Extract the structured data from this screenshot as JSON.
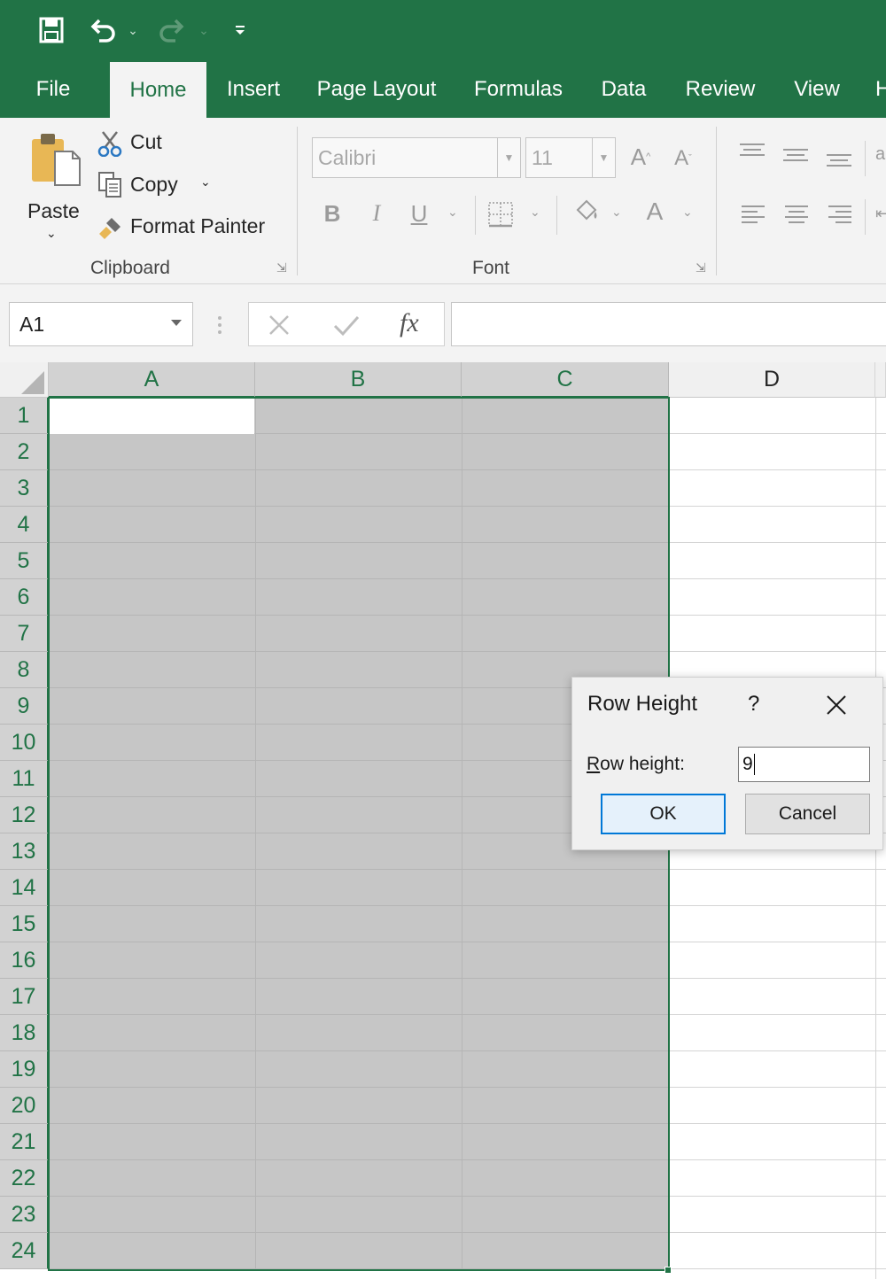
{
  "qat": {
    "save_icon": "save-icon",
    "undo_icon": "undo-icon",
    "redo_icon": "redo-icon",
    "customize_icon": "customize-qat-icon"
  },
  "tabs": [
    {
      "label": "File"
    },
    {
      "label": "Home"
    },
    {
      "label": "Insert"
    },
    {
      "label": "Page Layout"
    },
    {
      "label": "Formulas"
    },
    {
      "label": "Data"
    },
    {
      "label": "Review"
    },
    {
      "label": "View"
    },
    {
      "label": "H"
    }
  ],
  "ribbon": {
    "clipboard": {
      "paste": "Paste",
      "cut": "Cut",
      "copy": "Copy",
      "format_painter": "Format Painter",
      "group_label": "Clipboard"
    },
    "font": {
      "font_name": "Calibri",
      "font_size": "11",
      "bold": "B",
      "italic": "I",
      "underline": "U",
      "font_color": "A",
      "group_label": "Font"
    }
  },
  "formula_bar": {
    "name_box": "A1",
    "fx": "fx",
    "formula": ""
  },
  "grid": {
    "columns": [
      "A",
      "B",
      "C",
      "D"
    ],
    "rows": [
      "1",
      "2",
      "3",
      "4",
      "5",
      "6",
      "7",
      "8",
      "9",
      "10",
      "11",
      "12",
      "13",
      "14",
      "15",
      "16",
      "17",
      "18",
      "19",
      "20",
      "21",
      "22",
      "23",
      "24"
    ],
    "accent": "#217346"
  },
  "dialog": {
    "title": "Row Height",
    "help": "?",
    "label_first": "R",
    "label_rest": "ow height:",
    "value": "9",
    "ok": "OK",
    "cancel": "Cancel"
  }
}
